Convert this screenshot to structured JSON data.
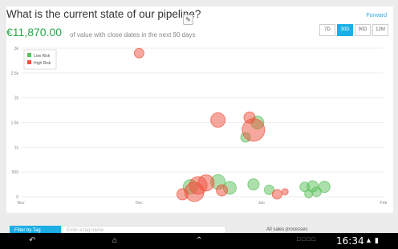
{
  "header": {
    "title": "What is the current state of our pipeline?",
    "edit_icon": "pencil-icon",
    "forward_label": "Forward",
    "amount": "€11,870.00",
    "amount_note": "of value with close dates in the next 90 days",
    "periods": [
      "7D",
      "30D",
      "90D",
      "12M"
    ],
    "active_period": "30D"
  },
  "colors": {
    "accent": "#1daee6",
    "amount": "#2aa64a",
    "low_risk": "#5cc05c",
    "high_risk": "#f0513d"
  },
  "legend": [
    {
      "label": "Low Risk",
      "color": "#5cc05c"
    },
    {
      "label": "High Risk",
      "color": "#f0513d"
    }
  ],
  "chart_data": {
    "type": "scatter",
    "title": "",
    "xlabel": "",
    "ylabel": "",
    "x_ticks": [
      "Nov",
      "Dec",
      "Jan",
      "Feb"
    ],
    "y_ticks": [
      "0",
      "500",
      "1k",
      "1.5k",
      "2k",
      "2.5k",
      "3k"
    ],
    "ylim": [
      0,
      3000
    ],
    "grid": true,
    "legend_position": "top-left",
    "series": [
      {
        "name": "Low Risk",
        "points": [
          {
            "x": "2013-12-14",
            "y": 200,
            "size": 9
          },
          {
            "x": "2013-12-21",
            "y": 300,
            "size": 9
          },
          {
            "x": "2013-12-24",
            "y": 180,
            "size": 8
          },
          {
            "x": "2013-12-28",
            "y": 1200,
            "size": 6
          },
          {
            "x": "2013-12-30",
            "y": 250,
            "size": 7
          },
          {
            "x": "2013-12-31",
            "y": 1500,
            "size": 8
          },
          {
            "x": "2014-01-03",
            "y": 140,
            "size": 6
          },
          {
            "x": "2014-01-12",
            "y": 200,
            "size": 6
          },
          {
            "x": "2014-01-13",
            "y": 60,
            "size": 5
          },
          {
            "x": "2014-01-14",
            "y": 210,
            "size": 7
          },
          {
            "x": "2014-01-15",
            "y": 100,
            "size": 6
          },
          {
            "x": "2014-01-17",
            "y": 200,
            "size": 7
          }
        ]
      },
      {
        "name": "High Risk",
        "points": [
          {
            "x": "2013-12-01",
            "y": 2900,
            "size": 6
          },
          {
            "x": "2013-12-12",
            "y": 50,
            "size": 7
          },
          {
            "x": "2013-12-16",
            "y": 230,
            "size": 11
          },
          {
            "x": "2013-12-15",
            "y": 100,
            "size": 12
          },
          {
            "x": "2013-12-18",
            "y": 280,
            "size": 10
          },
          {
            "x": "2013-12-21",
            "y": 1550,
            "size": 9
          },
          {
            "x": "2013-12-22",
            "y": 130,
            "size": 7
          },
          {
            "x": "2013-12-29",
            "y": 1600,
            "size": 7
          },
          {
            "x": "2013-12-30",
            "y": 1350,
            "size": 14
          },
          {
            "x": "2014-01-05",
            "y": 50,
            "size": 6
          },
          {
            "x": "2014-01-07",
            "y": 100,
            "size": 4
          }
        ]
      }
    ]
  },
  "footer": {
    "filter_label": "Filter by Tag",
    "filter_placeholder": "Enter a tag name",
    "processes_label": "All sales processes"
  },
  "system_bar": {
    "time": "16:34",
    "icons": [
      "back-icon",
      "home-icon",
      "recent-apps-icon",
      "screenshot-icon",
      "menu-up-icon"
    ]
  }
}
